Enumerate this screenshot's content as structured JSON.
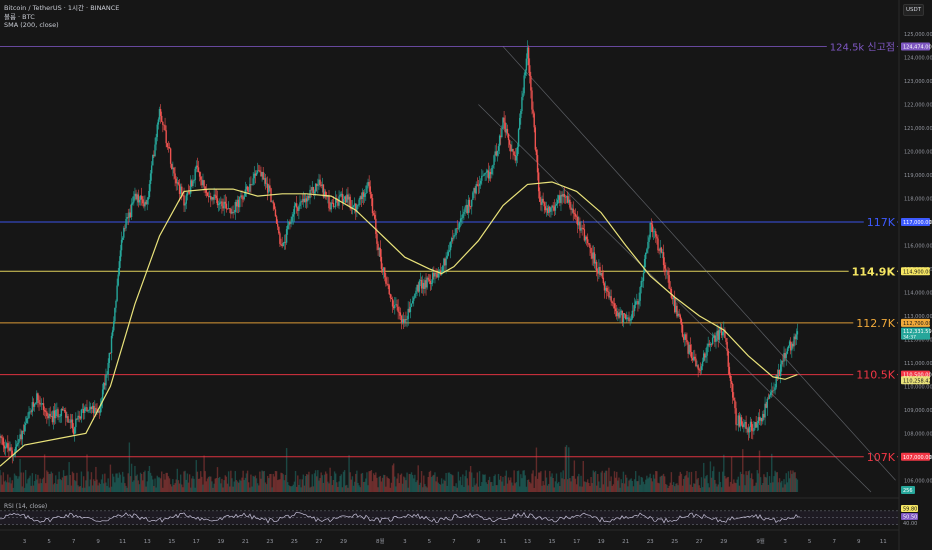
{
  "header": {
    "symbol_line": "Bitcoin / TetherUS · 1시간 · BINANCE",
    "volume_line": "볼륨 · BTC",
    "sma_line": "SMA (200, close)",
    "currency_button": "USDT"
  },
  "colors": {
    "background": "#161616",
    "candle_up": "#26a69a",
    "candle_down": "#ef5350",
    "sma": "#e9e27a",
    "level_blue": "#3d5afe",
    "level_yellow": "#f5e663",
    "level_orange": "#f0a93a",
    "level_red": "#f23645",
    "level_ath": "#7e57c2",
    "rsi": "#c5c0d8"
  },
  "chart_data": {
    "type": "candlestick",
    "title": "Bitcoin / TetherUS · 1시간 · BINANCE",
    "y_axis_ticks": [
      "106,000.00",
      "107,000.00",
      "108,000.00",
      "109,000.00",
      "110,000.00",
      "111,000.00",
      "112,000.00",
      "113,000.00",
      "114,000.00",
      "115,000.00",
      "116,000.00",
      "117,000.00",
      "118,000.00",
      "119,000.00",
      "120,000.00",
      "121,000.00",
      "122,000.00",
      "123,000.00",
      "124,000.00",
      "125,000.00"
    ],
    "y_range": [
      105500,
      125600
    ],
    "x_axis_ticks": [
      "3",
      "5",
      "7",
      "9",
      "11",
      "13",
      "15",
      "17",
      "19",
      "21",
      "23",
      "25",
      "27",
      "29",
      "8월",
      "3",
      "5",
      "7",
      "9",
      "11",
      "13",
      "15",
      "17",
      "19",
      "21",
      "23",
      "25",
      "27",
      "29",
      "9월",
      "3",
      "5",
      "7",
      "9",
      "11"
    ],
    "x_axis_label_days": [
      3,
      5,
      7,
      9,
      11,
      13,
      15,
      17,
      19,
      21,
      23,
      25,
      27,
      29,
      32,
      34,
      36,
      38,
      40,
      42,
      44,
      46,
      48,
      50,
      52,
      54,
      56,
      58,
      60,
      63,
      65,
      67,
      69,
      71,
      73
    ],
    "x_range_days": [
      1,
      74.2
    ],
    "price_path": [
      {
        "day": 1,
        "price": 107800
      },
      {
        "day": 2,
        "price": 107100
      },
      {
        "day": 3,
        "price": 108200
      },
      {
        "day": 4,
        "price": 109600
      },
      {
        "day": 5,
        "price": 108600
      },
      {
        "day": 6,
        "price": 109000
      },
      {
        "day": 7,
        "price": 108200
      },
      {
        "day": 8,
        "price": 109200
      },
      {
        "day": 9,
        "price": 108800
      },
      {
        "day": 10,
        "price": 111500
      },
      {
        "day": 11,
        "price": 116500
      },
      {
        "day": 12,
        "price": 118000
      },
      {
        "day": 13,
        "price": 117800
      },
      {
        "day": 14,
        "price": 121900
      },
      {
        "day": 15,
        "price": 119500
      },
      {
        "day": 16,
        "price": 117800
      },
      {
        "day": 17,
        "price": 119200
      },
      {
        "day": 18,
        "price": 118000
      },
      {
        "day": 19,
        "price": 117900
      },
      {
        "day": 20,
        "price": 117500
      },
      {
        "day": 21,
        "price": 118200
      },
      {
        "day": 22,
        "price": 119300
      },
      {
        "day": 23,
        "price": 118300
      },
      {
        "day": 24,
        "price": 115800
      },
      {
        "day": 25,
        "price": 117600
      },
      {
        "day": 26,
        "price": 117900
      },
      {
        "day": 27,
        "price": 118700
      },
      {
        "day": 28,
        "price": 117600
      },
      {
        "day": 29,
        "price": 118100
      },
      {
        "day": 30,
        "price": 117500
      },
      {
        "day": 31,
        "price": 118700
      },
      {
        "day": 32,
        "price": 115400
      },
      {
        "day": 33,
        "price": 113500
      },
      {
        "day": 34,
        "price": 112700
      },
      {
        "day": 35,
        "price": 114200
      },
      {
        "day": 36,
        "price": 114500
      },
      {
        "day": 37,
        "price": 115000
      },
      {
        "day": 38,
        "price": 116400
      },
      {
        "day": 39,
        "price": 117500
      },
      {
        "day": 40,
        "price": 118600
      },
      {
        "day": 41,
        "price": 119100
      },
      {
        "day": 42,
        "price": 121200
      },
      {
        "day": 43,
        "price": 119500
      },
      {
        "day": 44,
        "price": 124400
      },
      {
        "day": 45,
        "price": 117800
      },
      {
        "day": 46,
        "price": 117500
      },
      {
        "day": 47,
        "price": 118300
      },
      {
        "day": 48,
        "price": 117200
      },
      {
        "day": 49,
        "price": 116000
      },
      {
        "day": 50,
        "price": 114600
      },
      {
        "day": 51,
        "price": 113300
      },
      {
        "day": 52,
        "price": 112800
      },
      {
        "day": 53,
        "price": 113500
      },
      {
        "day": 54,
        "price": 116800
      },
      {
        "day": 55,
        "price": 115600
      },
      {
        "day": 56,
        "price": 113400
      },
      {
        "day": 57,
        "price": 111700
      },
      {
        "day": 58,
        "price": 110800
      },
      {
        "day": 59,
        "price": 112000
      },
      {
        "day": 60,
        "price": 112400
      },
      {
        "day": 61,
        "price": 108600
      },
      {
        "day": 62,
        "price": 108200
      },
      {
        "day": 63,
        "price": 108500
      },
      {
        "day": 64,
        "price": 109900
      },
      {
        "day": 65,
        "price": 111300
      },
      {
        "day": 66,
        "price": 112300
      }
    ],
    "sma_200": [
      {
        "day": 1,
        "price": 106600
      },
      {
        "day": 3,
        "price": 107500
      },
      {
        "day": 6,
        "price": 107800
      },
      {
        "day": 8,
        "price": 108000
      },
      {
        "day": 10,
        "price": 110000
      },
      {
        "day": 12,
        "price": 113500
      },
      {
        "day": 14,
        "price": 116400
      },
      {
        "day": 16,
        "price": 118300
      },
      {
        "day": 18,
        "price": 118400
      },
      {
        "day": 20,
        "price": 118400
      },
      {
        "day": 22,
        "price": 118100
      },
      {
        "day": 24,
        "price": 118200
      },
      {
        "day": 26,
        "price": 118200
      },
      {
        "day": 28,
        "price": 118100
      },
      {
        "day": 30,
        "price": 117500
      },
      {
        "day": 32,
        "price": 116500
      },
      {
        "day": 34,
        "price": 115500
      },
      {
        "day": 36,
        "price": 115000
      },
      {
        "day": 37,
        "price": 114800
      },
      {
        "day": 38,
        "price": 115100
      },
      {
        "day": 40,
        "price": 116200
      },
      {
        "day": 42,
        "price": 117700
      },
      {
        "day": 44,
        "price": 118600
      },
      {
        "day": 46,
        "price": 118700
      },
      {
        "day": 48,
        "price": 118300
      },
      {
        "day": 50,
        "price": 117400
      },
      {
        "day": 52,
        "price": 116000
      },
      {
        "day": 54,
        "price": 114700
      },
      {
        "day": 56,
        "price": 113800
      },
      {
        "day": 58,
        "price": 113000
      },
      {
        "day": 60,
        "price": 112400
      },
      {
        "day": 62,
        "price": 111300
      },
      {
        "day": 64,
        "price": 110400
      },
      {
        "day": 65,
        "price": 110300
      },
      {
        "day": 66,
        "price": 110500
      }
    ],
    "levels": [
      {
        "price": 124474,
        "label": "124.5k 신고점",
        "tag": "124,474.00",
        "color_key": "level_ath"
      },
      {
        "price": 117000,
        "label": "117K",
        "tag": "117,000.00",
        "color_key": "level_blue"
      },
      {
        "price": 114900,
        "label": "114.9K",
        "tag": "114,900.00",
        "color_key": "level_yellow"
      },
      {
        "price": 112700,
        "label": "112.7K",
        "tag": "112,700.00",
        "color_key": "level_orange"
      },
      {
        "price": 110500,
        "label": "110.5K",
        "tag": "110,500.00",
        "color_key": "level_red"
      },
      {
        "price": 107000,
        "label": "107K",
        "tag": "107,000.00",
        "color_key": "level_red"
      }
    ],
    "current_price": {
      "price": 112331.59,
      "tag": "112,331.59",
      "countdown": "34:37"
    },
    "sma_tag": {
      "price": 110258.42,
      "tag": "110,258.42"
    },
    "volume_tag": "256",
    "channel": {
      "upper": [
        {
          "day": 42,
          "price": 124474
        },
        {
          "day": 74,
          "price": 106000
        }
      ],
      "lower": [
        {
          "day": 40,
          "price": 122000
        },
        {
          "day": 72,
          "price": 105500
        }
      ]
    },
    "rsi": {
      "title": "RSI (14, close)",
      "values_tags": [
        "59.80",
        "50.50"
      ],
      "level_tag": "40.00",
      "bands": [
        70,
        50,
        30
      ]
    }
  }
}
